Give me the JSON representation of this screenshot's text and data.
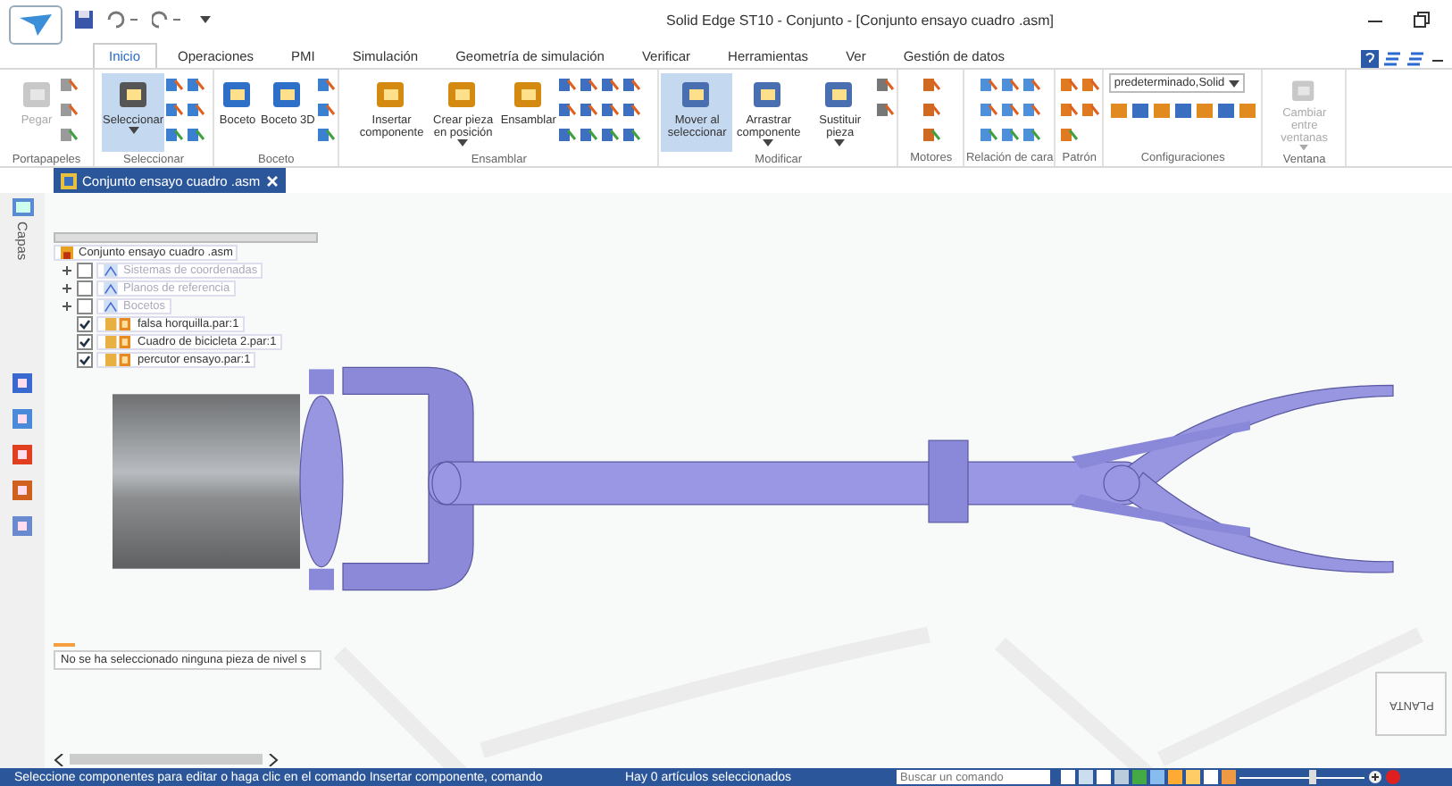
{
  "window": {
    "title": "Solid Edge ST10 - Conjunto - [Conjunto ensayo cuadro .asm]"
  },
  "tabs": [
    {
      "label": "Inicio",
      "selected": true
    },
    {
      "label": "Operaciones",
      "selected": false
    },
    {
      "label": "PMI",
      "selected": false
    },
    {
      "label": "Simulación",
      "selected": false
    },
    {
      "label": "Geometría de simulación",
      "selected": false
    },
    {
      "label": "Verificar",
      "selected": false
    },
    {
      "label": "Herramientas",
      "selected": false
    },
    {
      "label": "Ver",
      "selected": false
    },
    {
      "label": "Gestión de datos",
      "selected": false
    }
  ],
  "ribbon": {
    "groups": [
      {
        "label": "Portapapeles",
        "buttons": [
          {
            "label": "Pegar",
            "disabled": true,
            "selected": false,
            "menu": false
          }
        ]
      },
      {
        "label": "Seleccionar",
        "buttons": [
          {
            "label": "Seleccionar",
            "disabled": false,
            "selected": true,
            "menu": true
          }
        ]
      },
      {
        "label": "Boceto",
        "buttons": [
          {
            "label": "Boceto",
            "disabled": false,
            "selected": false,
            "menu": false
          },
          {
            "label": "Boceto 3D",
            "disabled": false,
            "selected": false,
            "menu": false
          }
        ]
      },
      {
        "label": "Ensamblar",
        "buttons": [
          {
            "label": "Insertar componente",
            "disabled": false,
            "selected": false,
            "menu": false
          },
          {
            "label": "Crear pieza en posición",
            "disabled": false,
            "selected": false,
            "menu": true
          },
          {
            "label": "Ensamblar",
            "disabled": false,
            "selected": false,
            "menu": false
          }
        ]
      },
      {
        "label": "Modificar",
        "buttons": [
          {
            "label": "Mover al seleccionar",
            "disabled": false,
            "selected": true,
            "menu": false
          },
          {
            "label": "Arrastrar componente",
            "disabled": false,
            "selected": false,
            "menu": true
          },
          {
            "label": "Sustituir pieza",
            "disabled": false,
            "selected": false,
            "menu": true
          }
        ]
      },
      {
        "label": "Motores"
      },
      {
        "label": "Relación de cara"
      },
      {
        "label": "Patrón"
      },
      {
        "label": "Configuraciones",
        "dropdown": "predeterminado,Solid"
      },
      {
        "label": "Ventana",
        "buttons": [
          {
            "label": "Cambiar entre ventanas",
            "disabled": true,
            "selected": false,
            "menu": true
          }
        ]
      }
    ]
  },
  "document_tab": {
    "label": "Conjunto ensayo cuadro .asm"
  },
  "side_panel": {
    "label": "Capas"
  },
  "tree": {
    "root": "Conjunto ensayo cuadro .asm",
    "children": [
      {
        "label": "Sistemas de coordenadas",
        "kind": "folder",
        "checked": false,
        "expandable": true,
        "dimmed": true
      },
      {
        "label": "Planos de referencia",
        "kind": "folder",
        "checked": false,
        "expandable": true,
        "dimmed": true
      },
      {
        "label": "Bocetos",
        "kind": "folder",
        "checked": false,
        "expandable": true,
        "dimmed": true
      },
      {
        "label": "falsa horquilla.par:1",
        "kind": "part",
        "checked": true,
        "expandable": false,
        "dimmed": false
      },
      {
        "label": "Cuadro de bicicleta 2.par:1",
        "kind": "part",
        "checked": true,
        "expandable": false,
        "dimmed": false
      },
      {
        "label": "percutor ensayo.par:1",
        "kind": "part",
        "checked": true,
        "expandable": false,
        "dimmed": false
      }
    ]
  },
  "message": "No se ha seleccionado ninguna pieza de nivel s",
  "view_cube": {
    "label": "PLANTA"
  },
  "status_bar": {
    "prompt": "Seleccione componentes para editar o haga clic en el comando Insertar componente, comando",
    "selection": "Hay 0 artículos seleccionados",
    "search": {
      "placeholder": "Buscar un comando"
    }
  }
}
